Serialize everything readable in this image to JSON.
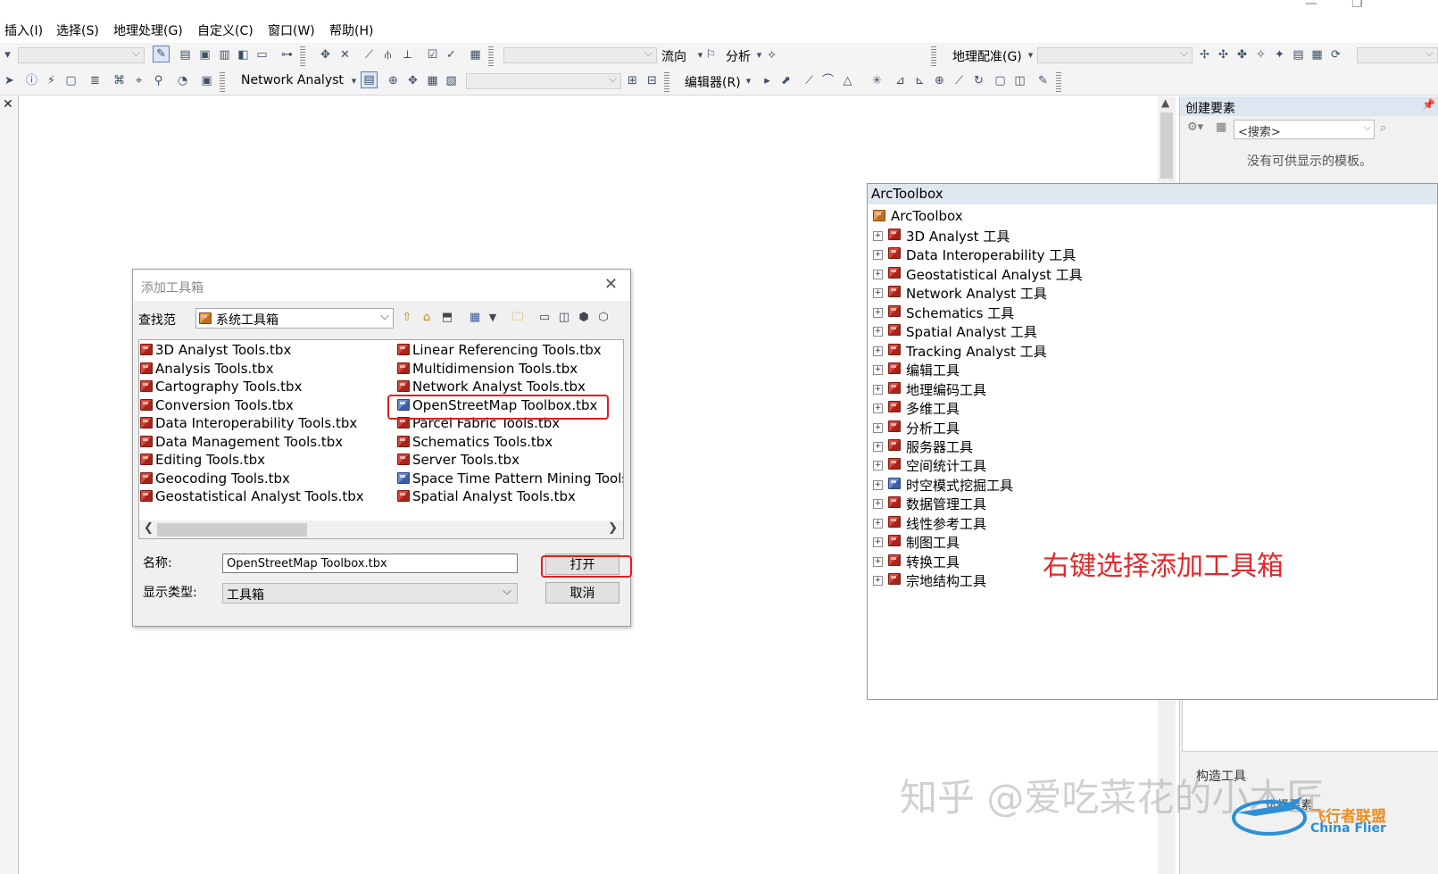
{
  "menubar": {
    "items": [
      "插入(I)",
      "选择(S)",
      "地理处理(G)",
      "自定义(C)",
      "窗口(W)",
      "帮助(H)"
    ]
  },
  "toolbar1": {
    "flow_label": "流向",
    "analysis_label": "分析",
    "georef_label": "地理配准(G)"
  },
  "toolbar2": {
    "network_analyst_label": "Network Analyst",
    "editor_label": "编辑器(R)"
  },
  "create_features": {
    "title": "创建要素",
    "search_placeholder": "<搜索>",
    "empty_message": "没有可供显示的模板。",
    "construct_tools": "构造工具",
    "construct_sub": "选择要素"
  },
  "arctoolbox": {
    "title": "ArcToolbox",
    "root": "ArcToolbox",
    "items": [
      "3D Analyst 工具",
      "Data Interoperability 工具",
      "Geostatistical Analyst 工具",
      "Network Analyst 工具",
      "Schematics 工具",
      "Spatial Analyst 工具",
      "Tracking Analyst 工具",
      "编辑工具",
      "地理编码工具",
      "多维工具",
      "分析工具",
      "服务器工具",
      "空间统计工具",
      "时空模式挖掘工具",
      "数据管理工具",
      "线性参考工具",
      "制图工具",
      "转换工具",
      "宗地结构工具"
    ]
  },
  "dialog": {
    "title": "添加工具箱",
    "look_in_label": "查找范",
    "look_in_value": "系统工具箱",
    "files_left": [
      "3D Analyst Tools.tbx",
      "Analysis Tools.tbx",
      "Cartography Tools.tbx",
      "Conversion Tools.tbx",
      "Data Interoperability Tools.tbx",
      "Data Management Tools.tbx",
      "Editing Tools.tbx",
      "Geocoding Tools.tbx",
      "Geostatistical Analyst Tools.tbx"
    ],
    "files_right": [
      "Linear Referencing Tools.tbx",
      "Multidimension Tools.tbx",
      "Network Analyst Tools.tbx",
      "OpenStreetMap Toolbox.tbx",
      "Parcel Fabric Tools.tbx",
      "Schematics Tools.tbx",
      "Server Tools.tbx",
      "Space Time Pattern Mining Tools.",
      "Spatial Analyst Tools.tbx"
    ],
    "name_label": "名称:",
    "name_value": "OpenStreetMap Toolbox.tbx",
    "type_label": "显示类型:",
    "type_value": "工具箱",
    "open_button": "打开",
    "cancel_button": "取消"
  },
  "annotation": "右键选择添加工具箱",
  "watermark": "知乎 @爱吃菜花的小木匠",
  "logo": {
    "cn": "飞行者联盟",
    "en": "China Flier"
  },
  "colors": {
    "highlight": "#e02020",
    "annotation": "#e8262a",
    "panel_header": "#dfe7f1"
  }
}
